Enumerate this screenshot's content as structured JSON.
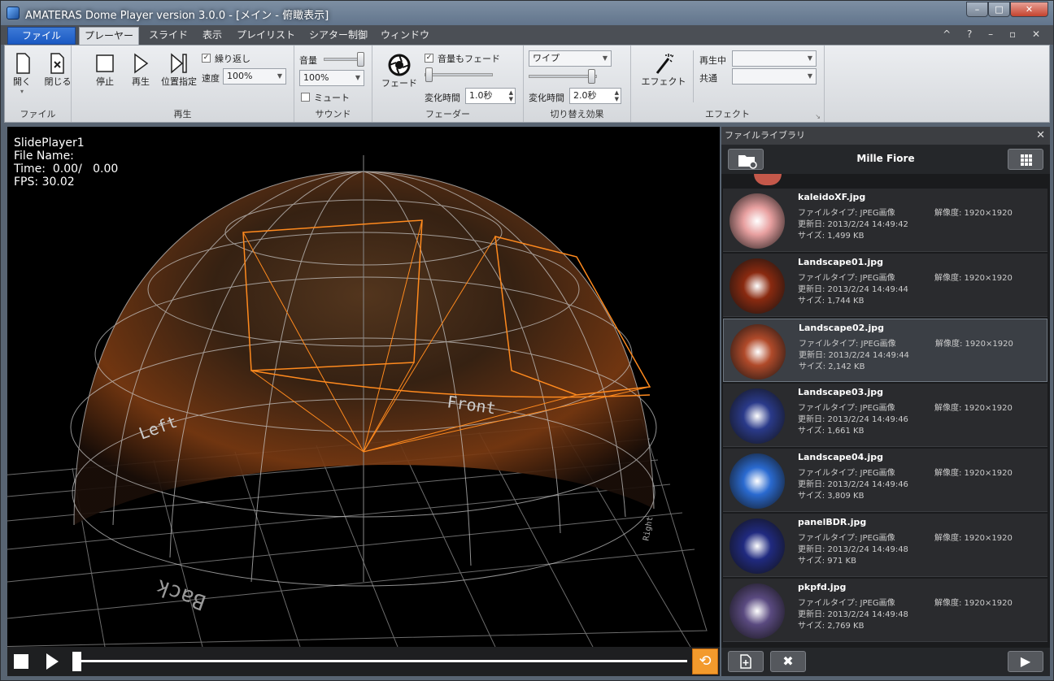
{
  "window": {
    "title": "AMATERAS Dome Player version 3.0.0 - [メイン - 俯瞰表示]"
  },
  "tabs": [
    {
      "label": "ファイル"
    },
    {
      "label": "プレーヤー"
    },
    {
      "label": "スライド"
    },
    {
      "label": "表示"
    },
    {
      "label": "プレイリスト"
    },
    {
      "label": "シアター制御"
    },
    {
      "label": "ウィンドウ"
    }
  ],
  "ribbon": {
    "file": {
      "open": "開く",
      "close": "閉じる",
      "label": "ファイル"
    },
    "playback": {
      "stop": "停止",
      "play": "再生",
      "seek": "位置指定",
      "repeat": "繰り返し",
      "speed_label": "速度",
      "speed_value": "100%",
      "label": "再生"
    },
    "sound": {
      "volume_label": "音量",
      "volume_value": "100%",
      "mute": "ミュート",
      "label": "サウンド",
      "volume_level": 1.0
    },
    "fader": {
      "fade": "フェード",
      "fade_volume": "音量もフェード",
      "time_label": "変化時間",
      "time_value": "1.0秒",
      "label": "フェーダー"
    },
    "transition": {
      "type": "ワイプ",
      "time_label": "変化時間",
      "time_value": "2.0秒",
      "label": "切り替え効果"
    },
    "effect": {
      "effect": "エフェクト",
      "playing": "再生中",
      "common": "共通",
      "label": "エフェクト"
    }
  },
  "viewport": {
    "player_name": "SlidePlayer1",
    "file_name_label": "File Name:",
    "time_label": "Time:",
    "time_value": "0.00/   0.00",
    "fps_label": "FPS:",
    "fps_value": "30.02",
    "labels": {
      "front": "Front",
      "left": "Left",
      "back": "Back",
      "right": "Right"
    }
  },
  "library": {
    "panel_title": "ファイルライブラリ",
    "folder_name": "Mille Fiore",
    "type_label": "ファイルタイプ: JPEG画像",
    "items": [
      {
        "name": "kaleidoXF.jpg",
        "date": "更新日: 2013/2/24 14:49:42",
        "size": "サイズ: 1,499 KB",
        "res": "解像度: 1920×1920",
        "selected": false,
        "color": "#e8a0a0"
      },
      {
        "name": "Landscape01.jpg",
        "date": "更新日: 2013/2/24 14:49:44",
        "size": "サイズ: 1,744 KB",
        "res": "解像度: 1920×1920",
        "selected": false,
        "color": "#8a2a10"
      },
      {
        "name": "Landscape02.jpg",
        "date": "更新日: 2013/2/24 14:49:44",
        "size": "サイズ: 2,142 KB",
        "res": "解像度: 1920×1920",
        "selected": true,
        "color": "#b04a2a"
      },
      {
        "name": "Landscape03.jpg",
        "date": "更新日: 2013/2/24 14:49:46",
        "size": "サイズ: 1,661 KB",
        "res": "解像度: 1920×1920",
        "selected": false,
        "color": "#2a3a8a"
      },
      {
        "name": "Landscape04.jpg",
        "date": "更新日: 2013/2/24 14:49:46",
        "size": "サイズ: 3,809 KB",
        "res": "解像度: 1920×1920",
        "selected": false,
        "color": "#2a6ad0"
      },
      {
        "name": "panelBDR.jpg",
        "date": "更新日: 2013/2/24 14:49:48",
        "size": "サイズ: 971 KB",
        "res": "解像度: 1920×1920",
        "selected": false,
        "color": "#202a80"
      },
      {
        "name": "pkpfd.jpg",
        "date": "更新日: 2013/2/24 14:49:48",
        "size": "サイズ: 2,769 KB",
        "res": "解像度: 1920×1920",
        "selected": false,
        "color": "#5a4a80"
      }
    ]
  },
  "playbar": {
    "position": 0.0
  }
}
